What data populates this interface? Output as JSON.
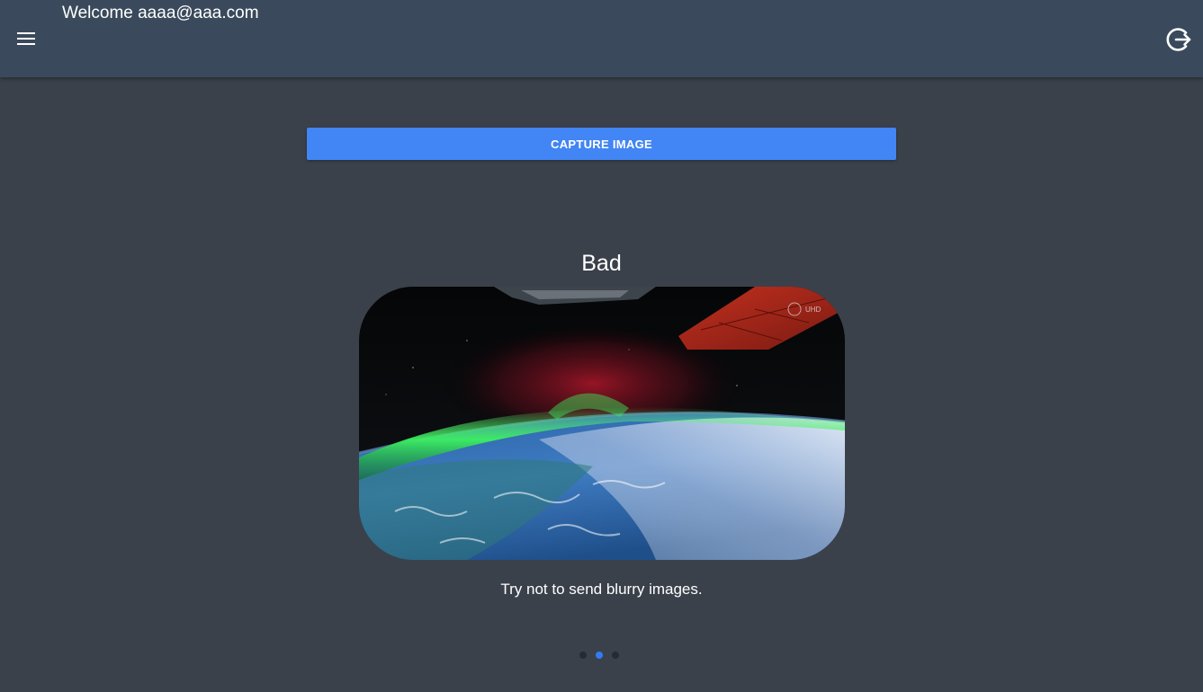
{
  "header": {
    "welcome_text": "Welcome aaaa@aaa.com",
    "menu_icon": "hamburger-menu-icon",
    "logout_icon": "logout-icon"
  },
  "actions": {
    "capture_label": "CAPTURE IMAGE"
  },
  "slide": {
    "title": "Bad",
    "caption": "Try not to send blurry images.",
    "image_watermark": "UHD"
  },
  "pager": {
    "total": 3,
    "active_index": 1
  },
  "colors": {
    "background": "#3b414b",
    "header": "#3a4a5c",
    "button": "#4285f4",
    "active_dot": "#2f7cf6",
    "inactive_dot": "#262b33"
  }
}
